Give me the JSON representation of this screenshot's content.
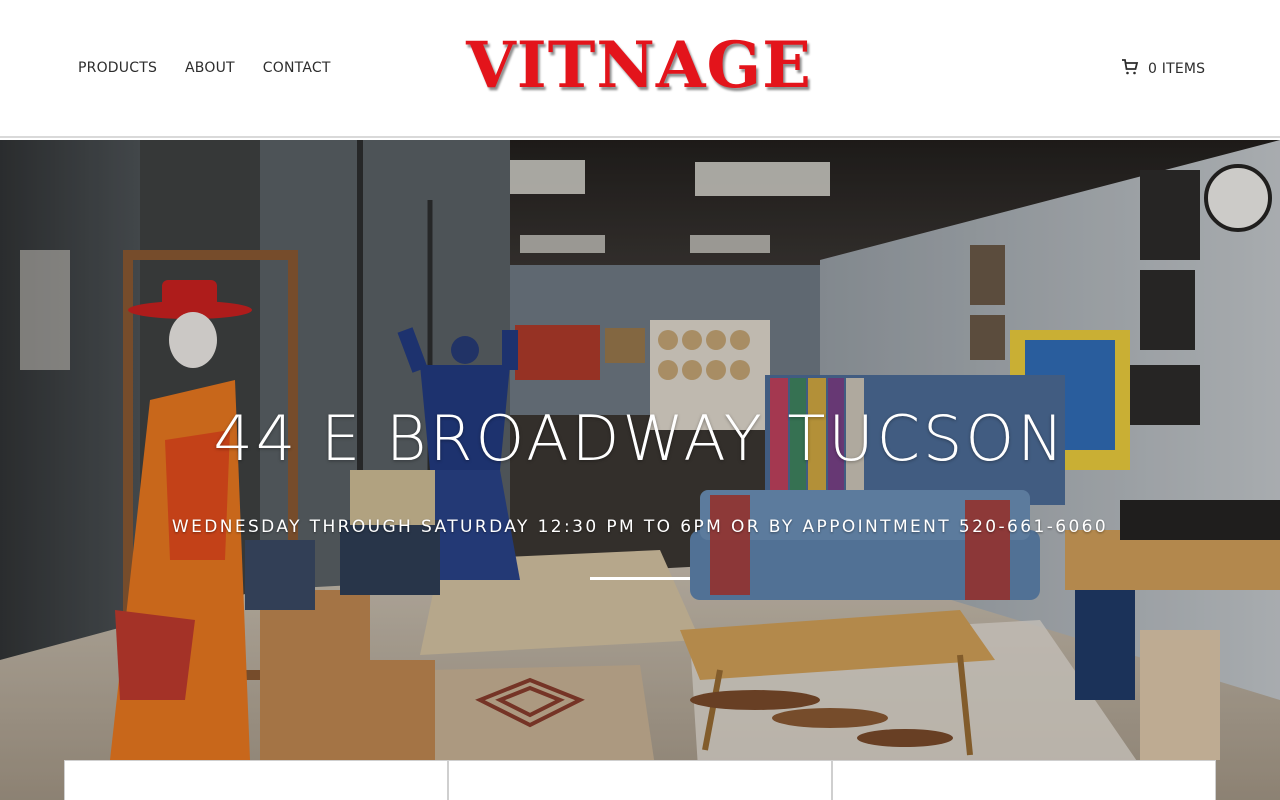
{
  "nav": {
    "items": [
      {
        "label": "PRODUCTS"
      },
      {
        "label": "ABOUT"
      },
      {
        "label": "CONTACT"
      }
    ]
  },
  "logo": {
    "text": "VITNAGE",
    "color": "#e3141b"
  },
  "cart": {
    "icon": "cart-icon",
    "label": "0 ITEMS"
  },
  "hero": {
    "title": "44 E BROADWAY TUCSON",
    "subtitle": "WEDNESDAY THROUGH SATURDAY 12:30 PM TO 6PM OR BY APPOINTMENT 520-661-6060"
  },
  "cards": [
    {},
    {},
    {}
  ],
  "colors": {
    "accent": "#e3141b",
    "text": "#2d2d2d",
    "background": "#ffffff"
  }
}
